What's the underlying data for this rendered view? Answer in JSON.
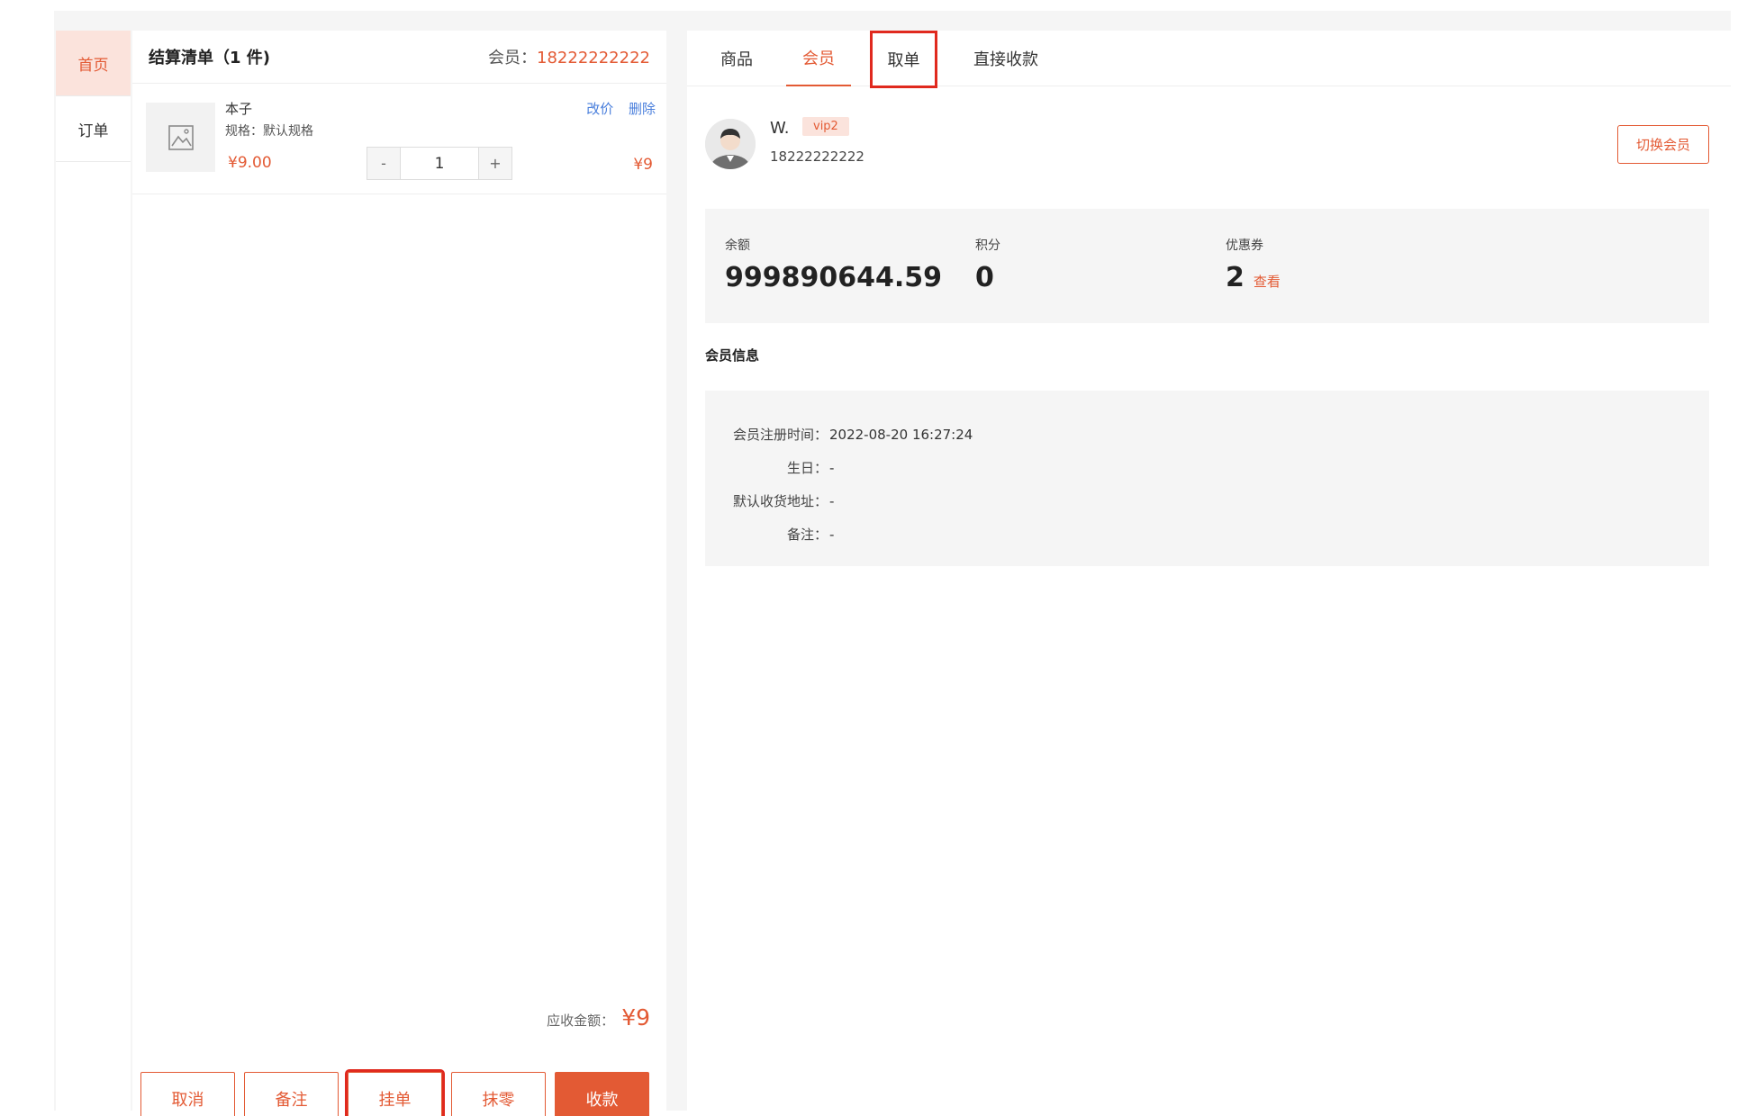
{
  "nav": {
    "items": [
      {
        "label": "首页",
        "active": true
      },
      {
        "label": "订单",
        "active": false
      }
    ]
  },
  "cart": {
    "title": "结算清单（1 件)",
    "member_label": "会员：",
    "member_phone": "18222222222",
    "items": [
      {
        "name": "本子",
        "spec": "规格：默认规格",
        "price": "¥9.00",
        "quantity": "1",
        "subtotal": "¥9",
        "edit_price_label": "改价",
        "delete_label": "删除"
      }
    ],
    "stepper": {
      "minus": "-",
      "plus": "+"
    },
    "due_label": "应收金额：",
    "due_value": "¥9",
    "buttons": {
      "cancel": "取消",
      "remark": "备注",
      "hang": "挂单",
      "round": "抹零",
      "collect": "收款"
    }
  },
  "tabs": [
    {
      "label": "商品",
      "active": false
    },
    {
      "label": "会员",
      "active": true
    },
    {
      "label": "取单",
      "active": false
    },
    {
      "label": "直接收款",
      "active": false
    }
  ],
  "member": {
    "name": "W.",
    "level": "vip2",
    "phone": "18222222222",
    "switch_label": "切换会员",
    "stats": {
      "balance_label": "余额",
      "balance": "999890644.59",
      "points_label": "积分",
      "points": "0",
      "coupons_label": "优惠券",
      "coupons": "2",
      "coupons_link": "查看"
    },
    "info_title": "会员信息",
    "info": [
      {
        "label": "会员注册时间：",
        "value": "2022-08-20 16:27:24"
      },
      {
        "label": "生日：",
        "value": "-"
      },
      {
        "label": "默认收货地址：",
        "value": "-"
      },
      {
        "label": "备注：",
        "value": "-"
      }
    ]
  },
  "colors": {
    "accent": "#e35a34",
    "highlight": "#e0291e",
    "link": "#4a7fdc"
  }
}
